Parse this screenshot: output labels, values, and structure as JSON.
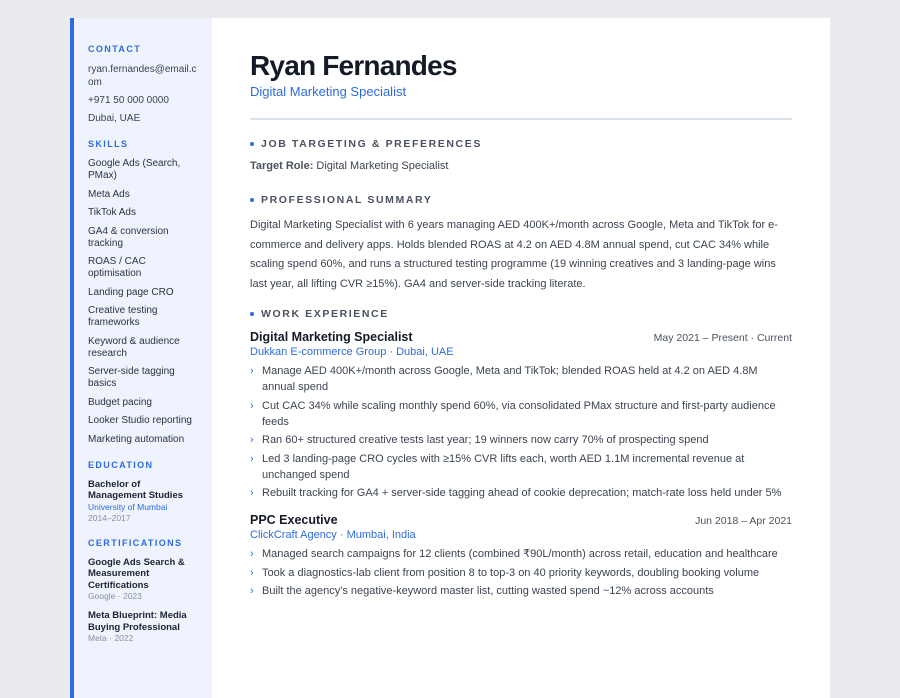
{
  "sidebar": {
    "contact_heading": "CONTACT",
    "contact": [
      "ryan.fernandes@email.com",
      "+971 50 000 0000",
      "Dubai, UAE"
    ],
    "skills_heading": "SKILLS",
    "skills": [
      "Google Ads (Search, PMax)",
      "Meta Ads",
      "TikTok Ads",
      "GA4 & conversion tracking",
      "ROAS / CAC optimisation",
      "Landing page CRO",
      "Creative testing frameworks",
      "Keyword & audience research",
      "Server-side tagging basics",
      "Budget pacing",
      "Looker Studio reporting",
      "Marketing automation"
    ],
    "education_heading": "EDUCATION",
    "education": {
      "degree": "Bachelor of Management Studies",
      "school": "University of Mumbai",
      "years": "2014–2017"
    },
    "certifications_heading": "CERTIFICATIONS",
    "certifications": [
      {
        "name": "Google Ads Search & Measurement Certifications",
        "meta": "Google · 2023"
      },
      {
        "name": "Meta Blueprint: Media Buying Professional",
        "meta": "Meta · 2022"
      }
    ]
  },
  "header": {
    "name": "Ryan Fernandes",
    "title": "Digital Marketing Specialist"
  },
  "targeting": {
    "heading": "JOB TARGETING & PREFERENCES",
    "label": "Target Role:",
    "value": "Digital Marketing Specialist"
  },
  "summary": {
    "heading": "PROFESSIONAL SUMMARY",
    "text": "Digital Marketing Specialist with 6 years managing AED 400K+/month across Google, Meta and TikTok for e-commerce and delivery apps. Holds blended ROAS at 4.2 on AED 4.8M annual spend, cut CAC 34% while scaling spend 60%, and runs a structured testing programme (19 winning creatives and 3 landing-page wins last year, all lifting CVR ≥15%). GA4 and server-side tracking literate."
  },
  "experience": {
    "heading": "WORK EXPERIENCE",
    "jobs": [
      {
        "title": "Digital Marketing Specialist",
        "dates": "May 2021 – Present · Current",
        "company": "Dukkan E-commerce Group · Dubai, UAE",
        "bullets": [
          "Manage AED 400K+/month across Google, Meta and TikTok; blended ROAS held at 4.2 on AED 4.8M annual spend",
          "Cut CAC 34% while scaling monthly spend 60%, via consolidated PMax structure and first-party audience feeds",
          "Ran 60+ structured creative tests last year; 19 winners now carry 70% of prospecting spend",
          "Led 3 landing-page CRO cycles with ≥15% CVR lifts each, worth AED 1.1M incremental revenue at unchanged spend",
          "Rebuilt tracking for GA4 + server-side tagging ahead of cookie deprecation; match-rate loss held under 5%"
        ]
      },
      {
        "title": "PPC Executive",
        "dates": "Jun 2018 – Apr 2021",
        "company": "ClickCraft Agency · Mumbai, India",
        "bullets": [
          "Managed search campaigns for 12 clients (combined ₹90L/month) across retail, education and healthcare",
          "Took a diagnostics-lab client from position 8 to top-3 on 40 priority keywords, doubling booking volume",
          "Built the agency's negative-keyword master list, cutting wasted spend ~12% across accounts"
        ]
      }
    ]
  },
  "colors": {
    "accent": "#2f6bdf",
    "sidebar_bg": "#eef3fd",
    "page_bg": "#e9ebef"
  }
}
